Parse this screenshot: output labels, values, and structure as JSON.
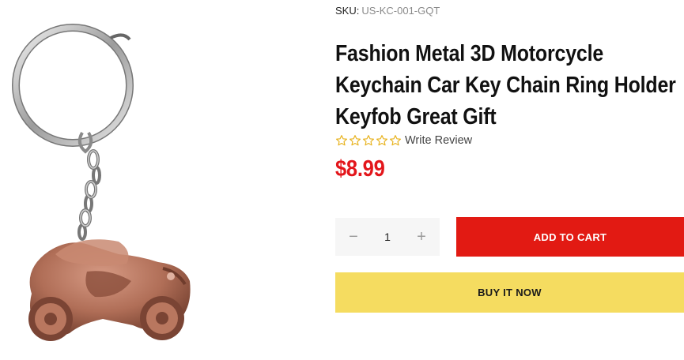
{
  "product": {
    "sku_label": "SKU:",
    "sku_value": "US-KC-001-GQT",
    "title": "Fashion Metal 3D Motorcycle Keychain Car Key Chain Ring Holder Keyfob Great Gift",
    "rating": {
      "stars": 0,
      "max": 5,
      "write_review_label": "Write Review"
    },
    "price": "$8.99"
  },
  "quantity": {
    "value": "1",
    "minus": "−",
    "plus": "+"
  },
  "actions": {
    "add_to_cart": "ADD TO CART",
    "buy_now": "BUY IT NOW"
  },
  "colors": {
    "price": "#e3161b",
    "add_to_cart_bg": "#e21a13",
    "buy_now_bg": "#f5dc60",
    "star": "#e8b422"
  }
}
